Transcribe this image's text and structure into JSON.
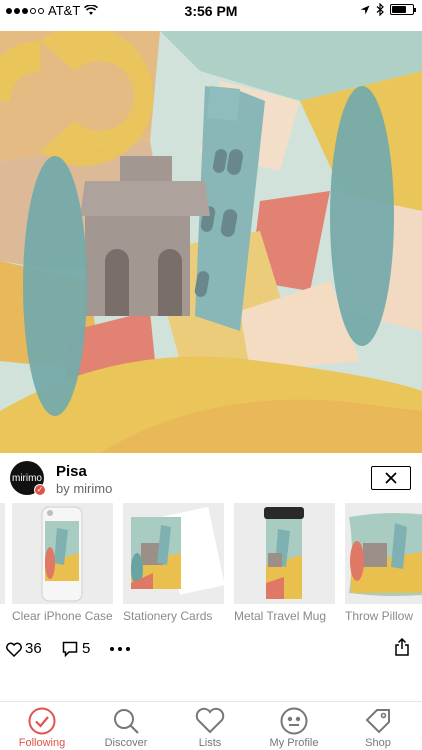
{
  "status_bar": {
    "carrier": "AT&T",
    "time": "3:56 PM"
  },
  "design": {
    "title": "Pisa",
    "byline": "by mirimo",
    "avatar_text": "mirimo"
  },
  "products": [
    {
      "label": "Clear iPhone Case"
    },
    {
      "label": "Stationery Cards"
    },
    {
      "label": "Metal Travel Mug"
    },
    {
      "label": "Throw Pillow"
    }
  ],
  "actions": {
    "likes": "36",
    "comments": "5"
  },
  "tabs": [
    {
      "label": "Following",
      "icon": "check-circle-icon"
    },
    {
      "label": "Discover",
      "icon": "search-icon"
    },
    {
      "label": "Lists",
      "icon": "heart-icon"
    },
    {
      "label": "My Profile",
      "icon": "face-icon"
    },
    {
      "label": "Shop",
      "icon": "tag-icon"
    }
  ],
  "colors": {
    "accent": "#e0544c",
    "art_teal": "#6aa3a3",
    "art_yellow": "#e9c04d",
    "art_coral": "#e07866",
    "art_taupe": "#9b8f88"
  }
}
